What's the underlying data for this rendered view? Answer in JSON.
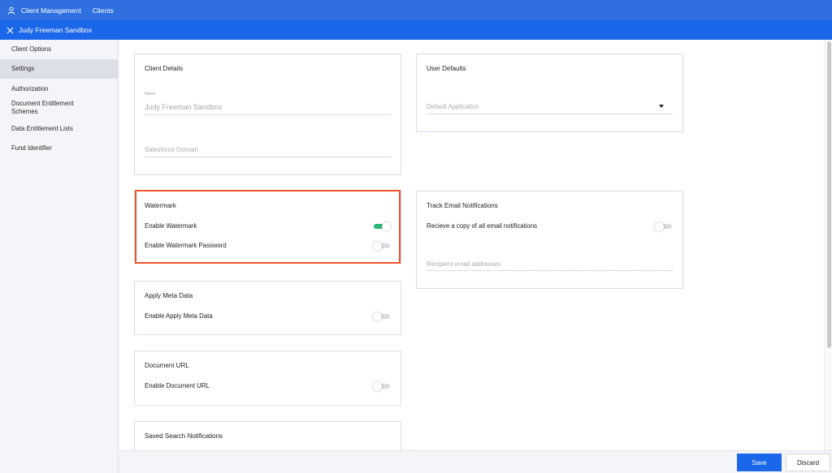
{
  "topbar": {
    "breadcrumb_1": "Client Management",
    "breadcrumb_2": "Clients",
    "icon": "user-icon"
  },
  "subbar": {
    "title": "Judy Freeman Sandbox",
    "icon": "close-icon"
  },
  "sidebar": {
    "items": [
      {
        "label": "Client Options"
      },
      {
        "label": "Settings",
        "active": true
      },
      {
        "label": "Authorization"
      },
      {
        "label": "Document Entitlement Schemes"
      },
      {
        "label": "Data Entitlement Lists"
      },
      {
        "label": "Fund Identifier"
      }
    ]
  },
  "client_details": {
    "title": "Client Details",
    "name_label": "Name",
    "name_value": "Judy Freeman Sandbox",
    "salesforce_placeholder": "Salesforce Domain"
  },
  "user_defaults": {
    "title": "User Defaults",
    "default_application_placeholder": "Default Application"
  },
  "watermark": {
    "title": "Watermark",
    "enable_label": "Enable Watermark",
    "enable_on": true,
    "password_label": "Enable Watermark Password",
    "password_on": false
  },
  "track_email": {
    "title": "Track Email Notifications",
    "copy_label": "Recieve a copy of all email notifications",
    "copy_on": false,
    "recipient_placeholder": "Recipient email addresses"
  },
  "apply_meta": {
    "title": "Apply Meta Data",
    "enable_label": "Enable Apply Meta Data",
    "enable_on": false
  },
  "document_url": {
    "title": "Document URL",
    "enable_label": "Enable Document URL",
    "enable_on": false
  },
  "saved_search": {
    "title": "Saved Search Notifications"
  },
  "footer": {
    "save_label": "Save",
    "discard_label": "Discard"
  },
  "colors": {
    "primary": "#1b67ea",
    "topbar": "#2f6fe0",
    "toggle_on": "#2bb673",
    "highlight": "#f0532a"
  }
}
